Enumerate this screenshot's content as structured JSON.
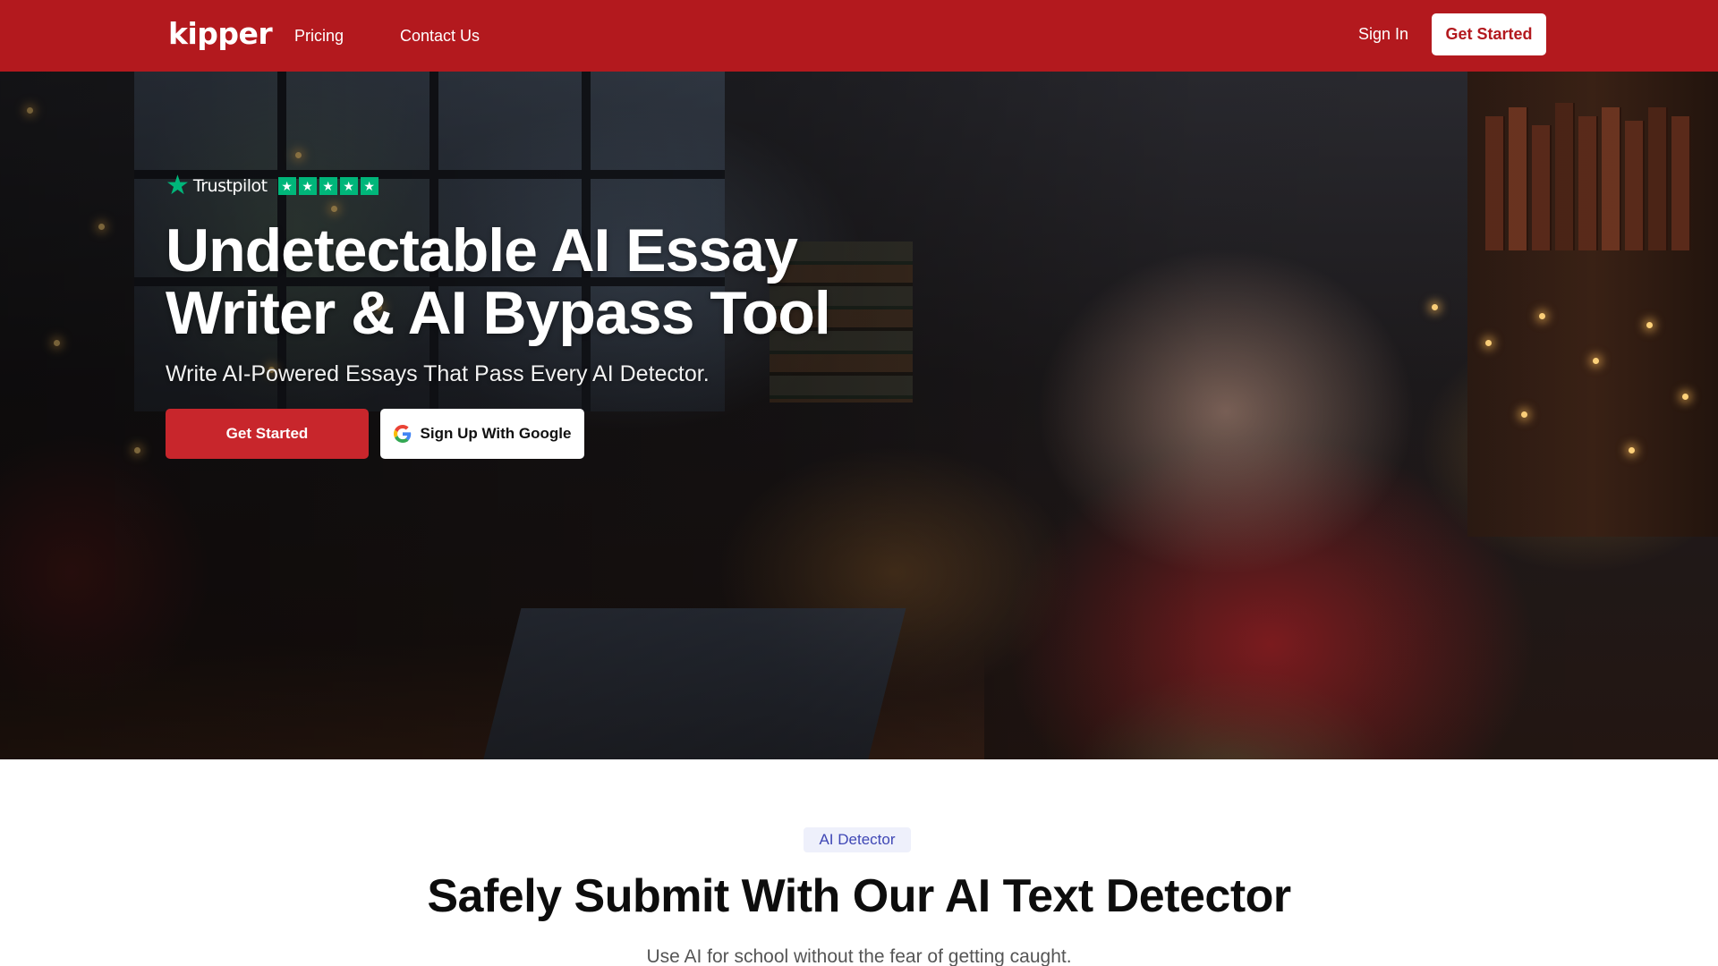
{
  "nav": {
    "logo": "kipper",
    "links": [
      {
        "label": "Pricing"
      },
      {
        "label": "Contact Us"
      }
    ],
    "sign_in": "Sign In",
    "cta": "Get Started"
  },
  "hero": {
    "rating_brand": "Trustpilot",
    "rating_stars": 5,
    "title": "Undetectable AI Essay Writer & AI Bypass Tool",
    "subtitle": "Write AI-Powered Essays That Pass Every AI Detector.",
    "cta": "Get Started",
    "google_button": "Sign Up With Google"
  },
  "section": {
    "badge": "AI Detector",
    "title": "Safely Submit With Our AI Text Detector",
    "subtitle": "Use AI for school without the fear of getting caught."
  },
  "colors": {
    "brand_red": "#b3191e",
    "trustpilot_green": "#00b67a",
    "badge_blue": "#3f47b5"
  }
}
